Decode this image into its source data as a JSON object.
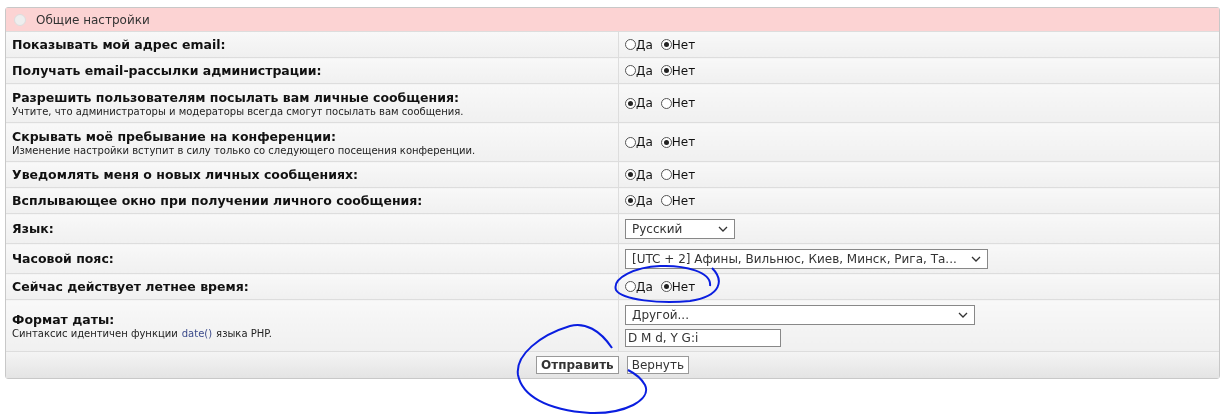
{
  "panel": {
    "title": "Общие настройки"
  },
  "rows": [
    {
      "kind": "radio",
      "label": "Показывать мой адрес email:",
      "options": [
        {
          "label": "Да",
          "selected": false
        },
        {
          "label": "Нет",
          "selected": true
        }
      ]
    },
    {
      "kind": "radio",
      "label": "Получать email-рассылки администрации:",
      "options": [
        {
          "label": "Да",
          "selected": false
        },
        {
          "label": "Нет",
          "selected": true
        }
      ]
    },
    {
      "kind": "radio",
      "label": "Разрешить пользователям посылать вам личные сообщения:",
      "hint": "Учтите, что администраторы и модераторы всегда смогут посылать вам сообщения.",
      "options": [
        {
          "label": "Да",
          "selected": true
        },
        {
          "label": "Нет",
          "selected": false
        }
      ]
    },
    {
      "kind": "radio",
      "label": "Скрывать моё пребывание на конференции:",
      "hint": "Изменение настройки вступит в силу только со следующего посещения конференции.",
      "options": [
        {
          "label": "Да",
          "selected": false
        },
        {
          "label": "Нет",
          "selected": true
        }
      ]
    },
    {
      "kind": "radio",
      "label": "Уведомлять меня о новых личных сообщениях:",
      "options": [
        {
          "label": "Да",
          "selected": true
        },
        {
          "label": "Нет",
          "selected": false
        }
      ]
    },
    {
      "kind": "radio",
      "label": "Всплывающее окно при получении личного сообщения:",
      "options": [
        {
          "label": "Да",
          "selected": true
        },
        {
          "label": "Нет",
          "selected": false
        }
      ]
    },
    {
      "kind": "select",
      "label": "Язык:",
      "value": "Русский"
    },
    {
      "kind": "select",
      "label": "Часовой пояс:",
      "value": "[UTC + 2] Афины, Вильнюс, Киев, Минск, Рига, Та..."
    },
    {
      "kind": "radio",
      "label": "Сейчас действует летнее время:",
      "options": [
        {
          "label": "Да",
          "selected": false
        },
        {
          "label": "Нет",
          "selected": true
        }
      ]
    },
    {
      "kind": "dateformat",
      "label": "Формат даты:",
      "hint": "Синтаксис идентичен функции",
      "hint_link": "date()",
      "hint_after": "языка PHP.",
      "value": "Другой...",
      "text": "D M d, Y G:i"
    }
  ],
  "buttons": [
    {
      "label": "Отправить",
      "primary": true
    },
    {
      "label": "Вернуть",
      "primary": false
    }
  ]
}
